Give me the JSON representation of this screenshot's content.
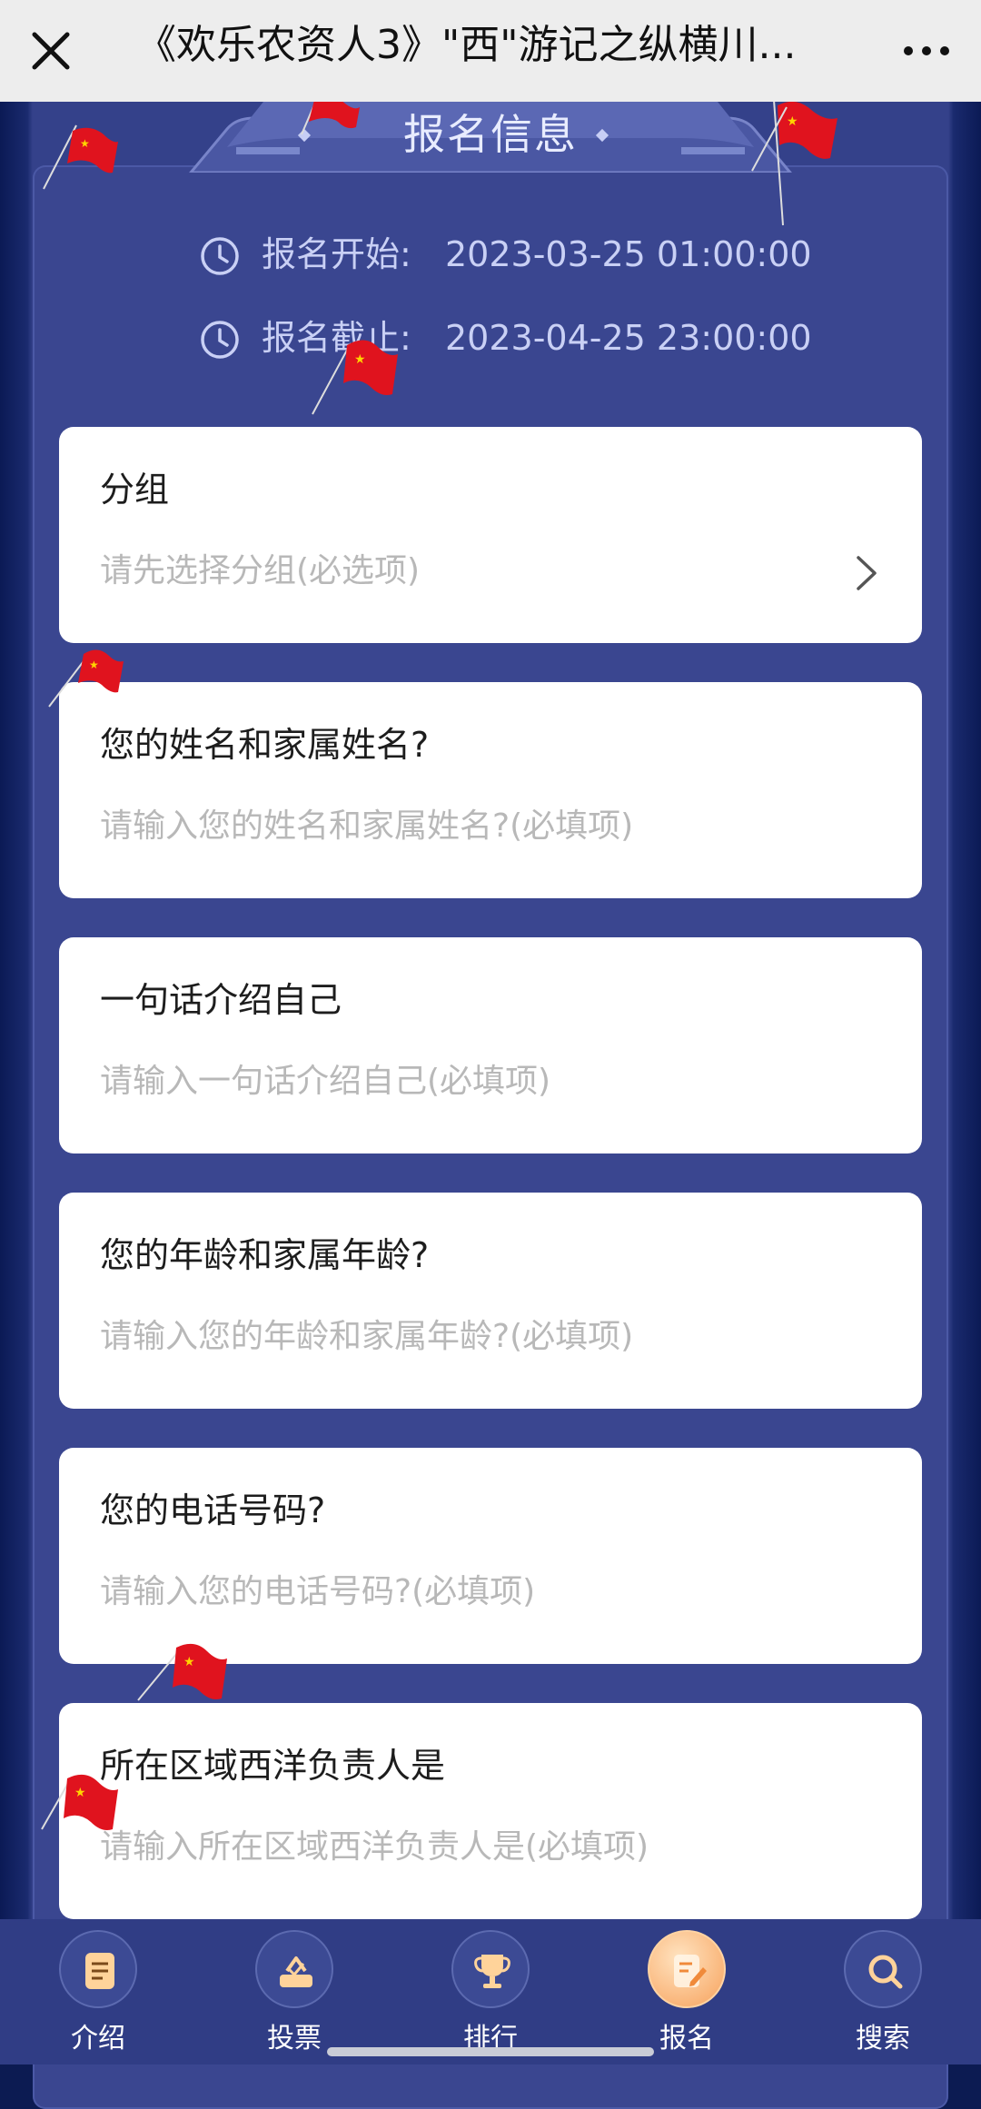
{
  "app": {
    "title": "《欢乐农资人3》\"西\"游记之纵横川..."
  },
  "header": {
    "label": "报名信息"
  },
  "times": {
    "start_label": "报名开始:",
    "start_value": "2023-03-25 01:00:00",
    "end_label": "报名截止:",
    "end_value": "2023-04-25 23:00:00"
  },
  "fields": [
    {
      "label": "分组",
      "placeholder": "请先选择分组(必选项)"
    },
    {
      "label": "您的姓名和家属姓名?",
      "placeholder": "请输入您的姓名和家属姓名?(必填项)"
    },
    {
      "label": "一句话介绍自己",
      "placeholder": "请输入一句话介绍自己(必填项)"
    },
    {
      "label": "您的年龄和家属年龄?",
      "placeholder": "请输入您的年龄和家属年龄?(必填项)"
    },
    {
      "label": "您的电话号码?",
      "placeholder": "请输入您的电话号码?(必填项)"
    },
    {
      "label": "所在区域西洋负责人是",
      "placeholder": "请输入所在区域西洋负责人是(必填项)"
    }
  ],
  "nav": [
    {
      "label": "介绍",
      "icon": "document-icon"
    },
    {
      "label": "投票",
      "icon": "vote-icon"
    },
    {
      "label": "排行",
      "icon": "trophy-icon"
    },
    {
      "label": "报名",
      "icon": "signup-icon",
      "active": true
    },
    {
      "label": "搜索",
      "icon": "search-icon"
    }
  ],
  "colors": {
    "page_bg": "#0c1b52",
    "panel": "#3a4690",
    "nav_bg": "#303d85",
    "active_tab": "#f7a25c",
    "flag_red": "#e0131e"
  }
}
